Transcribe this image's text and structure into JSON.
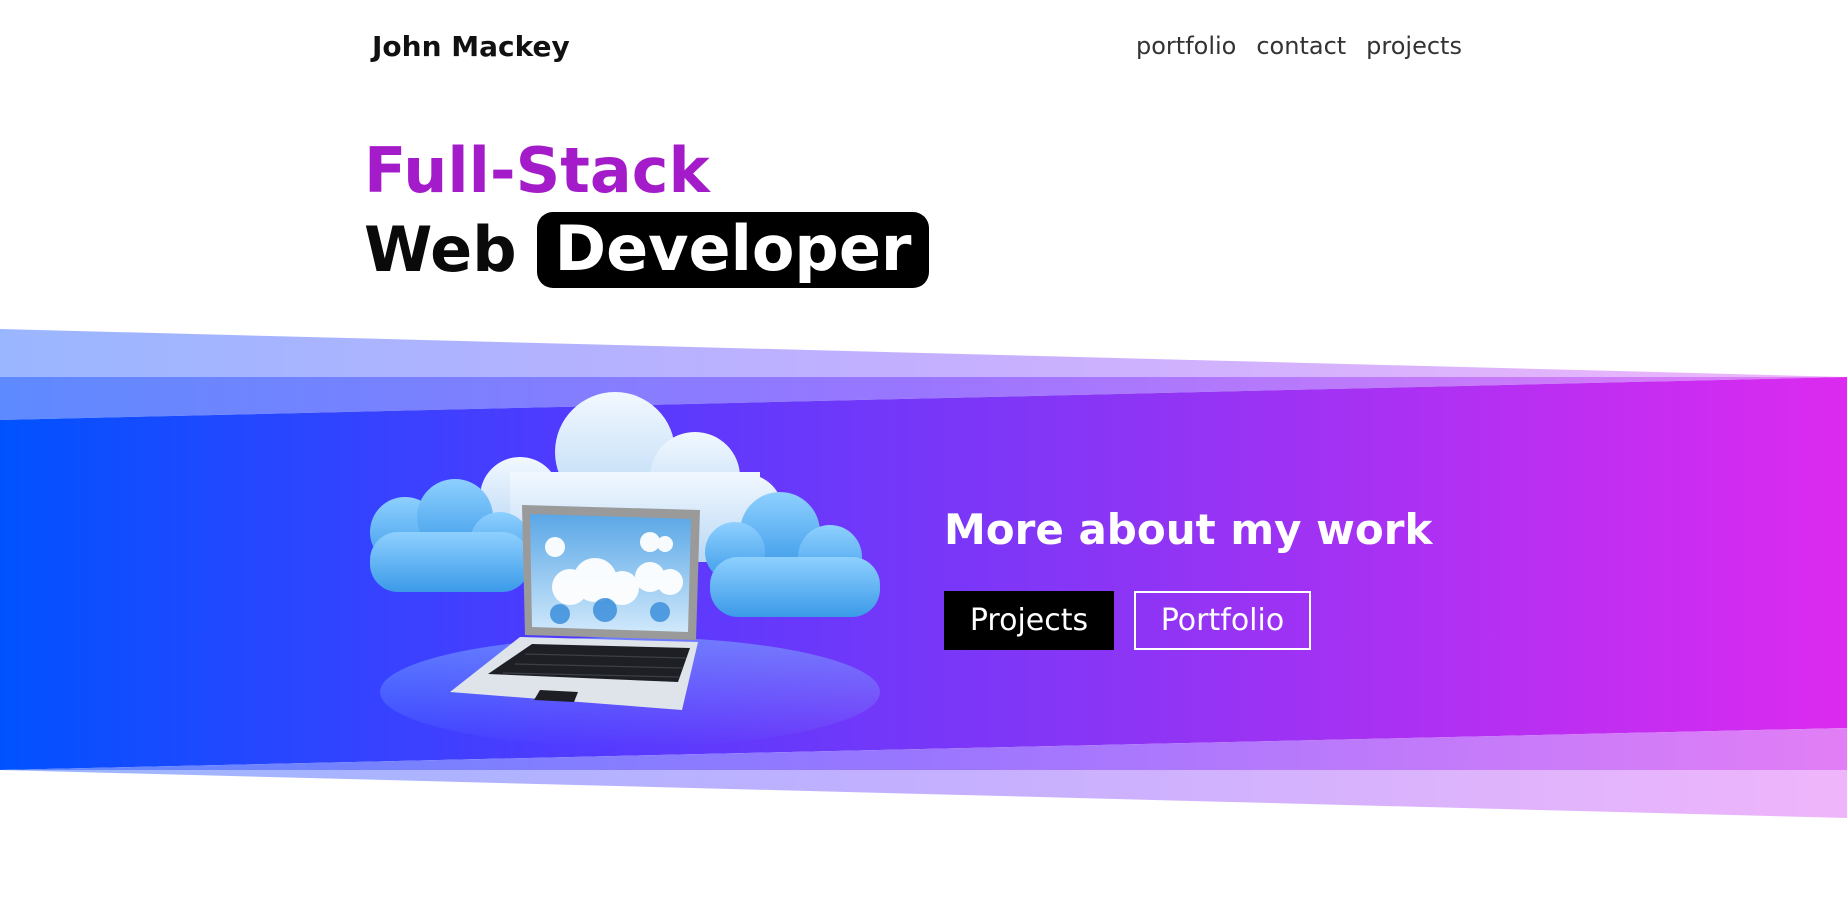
{
  "header": {
    "brand": "John Mackey",
    "nav": [
      {
        "label": "portfolio"
      },
      {
        "label": "contact"
      },
      {
        "label": "projects"
      }
    ]
  },
  "hero": {
    "line1": "Full-Stack",
    "line2_word": "Web",
    "line2_pill": "Developer"
  },
  "work": {
    "title": "More about my work",
    "buttons": {
      "projects": "Projects",
      "portfolio": "Portfolio"
    }
  },
  "colors": {
    "accent_purple": "#a41bc9",
    "band_start": "#0055ff",
    "band_mid": "#5b3dff",
    "band_end": "#d92af0"
  },
  "icons": {
    "illustration": "cloud-laptop-icon"
  }
}
